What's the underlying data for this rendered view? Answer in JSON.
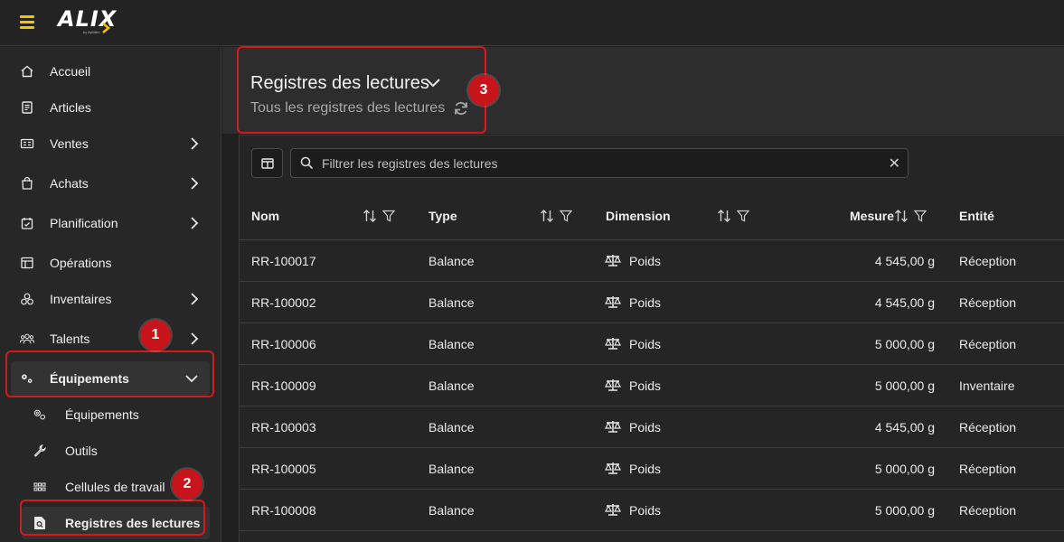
{
  "app": {
    "logo_text": "ALIX",
    "logo_sub": "by Apliden"
  },
  "sidebar": {
    "items": [
      {
        "label": "Accueil",
        "icon": "home-icon",
        "has_children": false
      },
      {
        "label": "Articles",
        "icon": "articles-icon",
        "has_children": false
      },
      {
        "label": "Ventes",
        "icon": "sales-icon",
        "has_children": true
      },
      {
        "label": "Achats",
        "icon": "shopping-bag-icon",
        "has_children": true
      },
      {
        "label": "Planification",
        "icon": "calendar-icon",
        "has_children": true
      },
      {
        "label": "Opérations",
        "icon": "operations-icon",
        "has_children": false
      },
      {
        "label": "Inventaires",
        "icon": "boxes-icon",
        "has_children": true
      },
      {
        "label": "Talents",
        "icon": "users-icon",
        "has_children": true
      },
      {
        "label": "Équipements",
        "icon": "gears-icon",
        "has_children": true,
        "expanded": true
      }
    ],
    "sub_items": [
      {
        "label": "Équipements",
        "icon": "gears-outline-icon"
      },
      {
        "label": "Outils",
        "icon": "wrench-icon"
      },
      {
        "label": "Cellules de travail",
        "icon": "grid-dots-icon"
      },
      {
        "label": "Registres des lectures",
        "icon": "file-search-icon",
        "current": true
      }
    ]
  },
  "annotations": {
    "badge1": "1",
    "badge2": "2",
    "badge3": "3"
  },
  "header": {
    "title": "Registres des lectures",
    "subtitle": "Tous les registres des lectures"
  },
  "filter": {
    "placeholder": "Filtrer les registres des lectures",
    "value": ""
  },
  "table": {
    "columns": [
      "Nom",
      "Type",
      "Dimension",
      "Mesure",
      "Entité"
    ],
    "rows": [
      {
        "nom": "RR-100017",
        "type": "Balance",
        "dimension": "Poids",
        "mesure": "4 545,00 g",
        "entite": "Réception"
      },
      {
        "nom": "RR-100002",
        "type": "Balance",
        "dimension": "Poids",
        "mesure": "4 545,00 g",
        "entite": "Réception"
      },
      {
        "nom": "RR-100006",
        "type": "Balance",
        "dimension": "Poids",
        "mesure": "5 000,00 g",
        "entite": "Réception"
      },
      {
        "nom": "RR-100009",
        "type": "Balance",
        "dimension": "Poids",
        "mesure": "5 000,00 g",
        "entite": "Inventaire"
      },
      {
        "nom": "RR-100003",
        "type": "Balance",
        "dimension": "Poids",
        "mesure": "4 545,00 g",
        "entite": "Réception"
      },
      {
        "nom": "RR-100005",
        "type": "Balance",
        "dimension": "Poids",
        "mesure": "5 000,00 g",
        "entite": "Réception"
      },
      {
        "nom": "RR-100008",
        "type": "Balance",
        "dimension": "Poids",
        "mesure": "5 000,00 g",
        "entite": "Réception"
      }
    ]
  },
  "colors": {
    "accent": "#f5c400",
    "annotation": "#d7191c",
    "background": "#1f1f1f"
  }
}
